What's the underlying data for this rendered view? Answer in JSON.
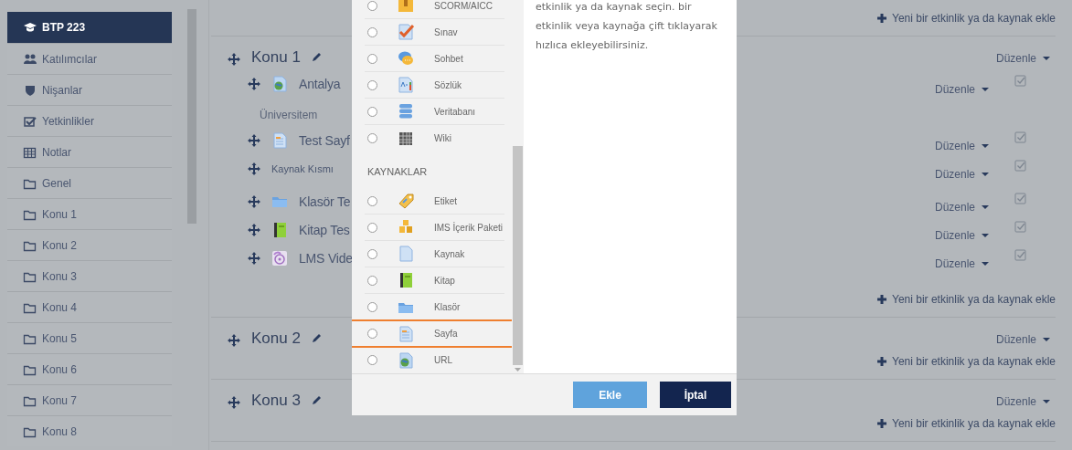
{
  "sidebar": {
    "items": [
      {
        "label": "BTP 223",
        "selected": true
      },
      {
        "label": "Katılımcılar",
        "selected": false
      },
      {
        "label": "Nişanlar",
        "selected": false
      },
      {
        "label": "Yetkinlikler",
        "selected": false
      },
      {
        "label": "Notlar",
        "selected": false
      },
      {
        "label": "Genel",
        "selected": false
      },
      {
        "label": "Konu 1",
        "selected": false
      },
      {
        "label": "Konu 2",
        "selected": false
      },
      {
        "label": "Konu 3",
        "selected": false
      },
      {
        "label": "Konu 4",
        "selected": false
      },
      {
        "label": "Konu 5",
        "selected": false
      },
      {
        "label": "Konu 6",
        "selected": false
      },
      {
        "label": "Konu 7",
        "selected": false
      },
      {
        "label": "Konu 8",
        "selected": false
      }
    ]
  },
  "sections": [
    {
      "add_link": "Yeni bir etkinlik ya da kaynak ekle"
    },
    {
      "title": "Konu 1",
      "edit": "Düzenle",
      "activities": [
        {
          "kind": "activity",
          "name": "Antalya",
          "edit": "Düzenle",
          "completion_checked": true
        },
        {
          "kind": "description",
          "name": "Üniversitem"
        },
        {
          "kind": "activity",
          "name": "Test Sayf",
          "edit": "Düzenle",
          "completion_checked": true
        },
        {
          "kind": "label",
          "name": "Kaynak Kısmı",
          "edit": "Düzenle",
          "completion_checked": true
        },
        {
          "kind": "activity",
          "name": "Klasör Te",
          "edit": "Düzenle",
          "completion_checked": true
        },
        {
          "kind": "activity",
          "name": "Kitap Tes",
          "edit": "Düzenle",
          "completion_checked": true
        },
        {
          "kind": "activity",
          "name": "LMS Vide",
          "edit": "Düzenle",
          "completion_checked": true
        }
      ],
      "add_link": "Yeni bir etkinlik ya da kaynak ekle"
    },
    {
      "title": "Konu 2",
      "edit": "Düzenle",
      "add_link": "Yeni bir etkinlik ya da kaynak ekle"
    },
    {
      "title": "Konu 3",
      "edit": "Düzenle",
      "add_link": "Yeni bir etkinlik ya da kaynak ekle"
    }
  ],
  "modal": {
    "activities": [
      {
        "label": "SCORM/AICC",
        "selected": false,
        "highlighted": false
      },
      {
        "label": "Sınav",
        "selected": false,
        "highlighted": false
      },
      {
        "label": "Sohbet",
        "selected": false,
        "highlighted": false
      },
      {
        "label": "Sözlük",
        "selected": false,
        "highlighted": false
      },
      {
        "label": "Veritabanı",
        "selected": false,
        "highlighted": false
      },
      {
        "label": "Wiki",
        "selected": false,
        "highlighted": false
      }
    ],
    "resources_heading": "KAYNAKLAR",
    "resources": [
      {
        "label": "Etiket",
        "selected": false,
        "highlighted": false
      },
      {
        "label": "IMS İçerik Paketi",
        "selected": false,
        "highlighted": false
      },
      {
        "label": "Kaynak",
        "selected": false,
        "highlighted": false
      },
      {
        "label": "Kitap",
        "selected": false,
        "highlighted": false
      },
      {
        "label": "Klasör",
        "selected": false,
        "highlighted": false
      },
      {
        "label": "Sayfa",
        "selected": false,
        "highlighted": true
      },
      {
        "label": "URL",
        "selected": false,
        "highlighted": false
      }
    ],
    "help_text": "etkinlik ya da kaynak seçin. bir etkinlik veya kaynağa çift tıklayarak hızlıca ekleyebilirsiniz.",
    "buttons": [
      {
        "label": "Ekle",
        "kind": "primary"
      },
      {
        "label": "İptal",
        "kind": "cancel"
      }
    ]
  }
}
